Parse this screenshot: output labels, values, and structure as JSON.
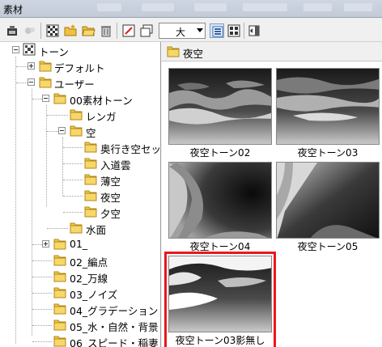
{
  "window": {
    "title": "素材"
  },
  "toolbar": {
    "size_value": "大",
    "icons": [
      "tool-icon",
      "shop-icon",
      "pattern-icon",
      "new-folder-icon",
      "open-folder-icon",
      "trash-icon",
      "edit-icon",
      "window-icon",
      "large-icon-view-icon",
      "tile-view-icon",
      "panel-toggle-icon"
    ]
  },
  "tree": {
    "root": "トーン",
    "items": [
      {
        "label": "デフォルト"
      },
      {
        "label": "ユーザー"
      },
      {
        "label": "00素材トーン"
      },
      {
        "label": "レンガ"
      },
      {
        "label": "空"
      },
      {
        "label": "奥行き空セッ"
      },
      {
        "label": "入道雲"
      },
      {
        "label": "薄空"
      },
      {
        "label": "夜空"
      },
      {
        "label": "夕空"
      },
      {
        "label": "水面"
      },
      {
        "label": "01_"
      },
      {
        "label": "02_編点"
      },
      {
        "label": "02_万線"
      },
      {
        "label": "03_ノイズ"
      },
      {
        "label": "04_グラデーション"
      },
      {
        "label": "05_水・自然・背景"
      },
      {
        "label": "06_スピード・稲妻"
      }
    ]
  },
  "path": {
    "current": "夜空"
  },
  "materials": [
    {
      "caption": "夜空トーン02"
    },
    {
      "caption": "夜空トーン03"
    },
    {
      "caption": "夜空トーン04"
    },
    {
      "caption": "夜空トーン05"
    },
    {
      "caption": "夜空トーン03影無し",
      "selected": true
    }
  ]
}
